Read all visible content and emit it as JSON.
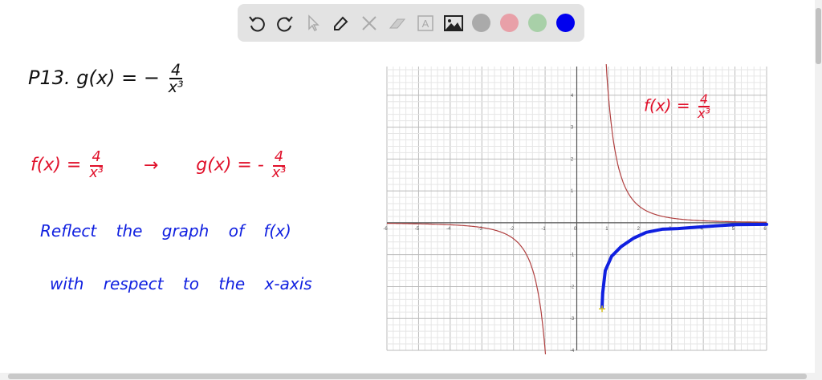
{
  "toolbar": {
    "tools": [
      "undo-icon",
      "redo-icon",
      "select-icon",
      "pen-icon",
      "tools-icon",
      "eraser-icon",
      "text-icon",
      "image-icon"
    ],
    "colors": [
      "#aaaaaa",
      "#e8a0a8",
      "#a8d0a8",
      "#0000ee"
    ],
    "selected_color": "#0000ee"
  },
  "notes": {
    "problem_label": "P13.",
    "problem_lhs": "g(x) = −",
    "problem_num": "4",
    "problem_den": "x³",
    "f_lhs": "f(x) =",
    "f_num": "4",
    "f_den": "x³",
    "arrow": "→",
    "g_lhs": "g(x) = -",
    "g_num": "4",
    "g_den": "x³",
    "line1": "Reflect the graph of f(x)",
    "line2": "with respect to the x-axis",
    "graph_label_lhs": "f(x) =",
    "graph_label_num": "4",
    "graph_label_den": "x³"
  },
  "chart_data": {
    "type": "line",
    "xlim": [
      -6,
      6
    ],
    "ylim": [
      -4,
      4.9
    ],
    "x_ticks": [
      -6,
      -5,
      -4,
      -3,
      -2,
      -1,
      0,
      1,
      2,
      3,
      4,
      5,
      6
    ],
    "y_ticks": [
      -4,
      -3,
      -2,
      -1,
      1,
      2,
      3,
      4
    ],
    "grid": true,
    "series": [
      {
        "name": "f(x) = 4/x³",
        "color": "#b04040",
        "formula": "4/x^3"
      },
      {
        "name": "hand-drawn g(x)",
        "color": "#1020e0",
        "points": [
          [
            0.8,
            -2.65
          ],
          [
            0.82,
            -2.2
          ],
          [
            0.9,
            -1.5
          ],
          [
            1.1,
            -1.05
          ],
          [
            1.4,
            -0.75
          ],
          [
            1.8,
            -0.48
          ],
          [
            2.2,
            -0.3
          ],
          [
            2.7,
            -0.2
          ],
          [
            3.2,
            -0.18
          ],
          [
            4,
            -0.12
          ],
          [
            5,
            -0.06
          ],
          [
            6,
            -0.05
          ]
        ]
      }
    ],
    "marker": {
      "x": 0.8,
      "y": -2.7,
      "color": "#d4c020"
    }
  }
}
